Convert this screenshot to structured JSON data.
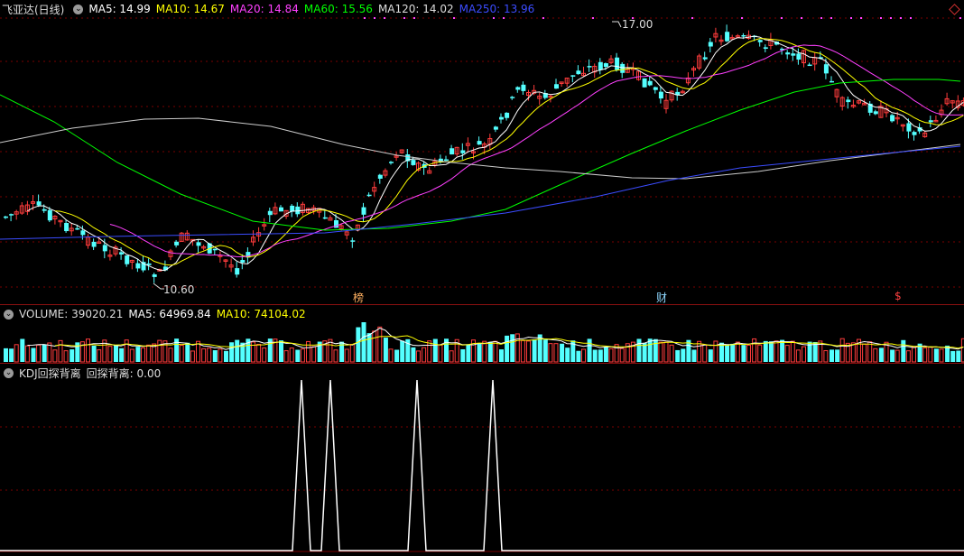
{
  "price_header": {
    "title": "飞亚达(日线)",
    "ma5": "MA5: 14.99",
    "ma10": "MA10: 14.67",
    "ma20": "MA20: 14.84",
    "ma60": "MA60: 15.56",
    "ma120": "MA120: 14.02",
    "ma250": "MA250: 13.96"
  },
  "price_annotations": {
    "high": "17.00",
    "low": "10.60"
  },
  "event_markers": {
    "list": "榜",
    "finance": "财",
    "dividend": "$"
  },
  "volume_header": {
    "title": "VOLUME: 39020.21",
    "ma5": "MA5: 64969.84",
    "ma10": "MA10: 74104.02"
  },
  "indicator_header": {
    "title": "KDJ回探背离",
    "value": "回探背离: 0.00"
  },
  "colors": {
    "up": "#ff3c3c",
    "down": "#54ffff",
    "ma5": "#ffffff",
    "ma10": "#ffff00",
    "ma20": "#ff40ff",
    "ma60": "#00ff00",
    "ma120": "#cccccc",
    "ma250": "#3b4cff"
  },
  "icons": {
    "header_toggle": "circle-chevron-icon",
    "corner": "diamond-icon"
  }
}
